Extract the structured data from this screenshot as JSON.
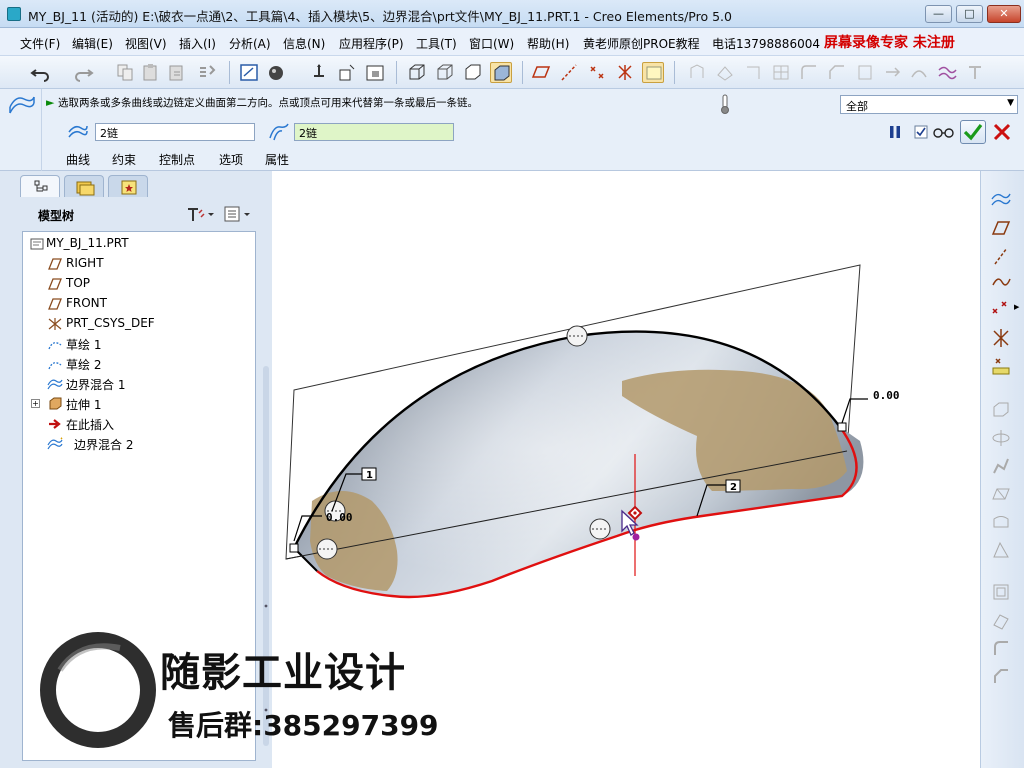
{
  "window": {
    "title": "MY_BJ_11 (活动的) E:\\破衣一点通\\2、工具篇\\4、插入模块\\5、边界混合\\prt文件\\MY_BJ_11.PRT.1 - Creo Elements/Pro 5.0",
    "minimize_glyph": "—",
    "maximize_glyph": "□",
    "close_glyph": "✕"
  },
  "menu": {
    "items": [
      "文件(F)",
      "编辑(E)",
      "视图(V)",
      "插入(I)",
      "分析(A)",
      "信息(N)",
      "应用程序(P)",
      "工具(T)",
      "窗口(W)",
      "帮助(H)",
      "黄老师原创PROE教程",
      "电话13798886004"
    ],
    "recorder_label": "屏幕录像专家  未注册"
  },
  "dashboard": {
    "message": "选取两条或多条曲线或边链定义曲面第二方向。点或顶点可用来代替第一条或最后一条链。",
    "filter_value": "全部",
    "chain1_value": "2链",
    "chain2_value": "2链",
    "tabs": [
      "曲线",
      "约束",
      "控制点",
      "选项",
      "属性"
    ]
  },
  "model_tree": {
    "title": "模型树",
    "items": [
      {
        "label": "MY_BJ_11.PRT",
        "icon": "part-icon"
      },
      {
        "label": "RIGHT",
        "icon": "datum-plane-icon"
      },
      {
        "label": "TOP",
        "icon": "datum-plane-icon"
      },
      {
        "label": "FRONT",
        "icon": "datum-plane-icon"
      },
      {
        "label": "PRT_CSYS_DEF",
        "icon": "csys-icon"
      },
      {
        "label": "草绘 1",
        "icon": "sketch-icon"
      },
      {
        "label": "草绘 2",
        "icon": "sketch-icon"
      },
      {
        "label": "边界混合 1",
        "icon": "boundary-blend-icon"
      },
      {
        "label": "拉伸 1",
        "icon": "extrude-icon"
      },
      {
        "label": "在此插入",
        "icon": "insert-here-icon"
      },
      {
        "label": "边界混合 2",
        "icon": "boundary-blend-icon"
      }
    ]
  },
  "canvas": {
    "dim_right": "0.00",
    "dim_left": "0.00",
    "label_1": "1",
    "label_2": "2"
  },
  "watermark": {
    "brand": "随影工业设计",
    "qq_group": "售后群:385297399"
  },
  "colors": {
    "accent": "#2a78d0",
    "curve_red": "#e01010",
    "ok_green": "#1a9a1a",
    "cancel_red": "#cc1010"
  }
}
